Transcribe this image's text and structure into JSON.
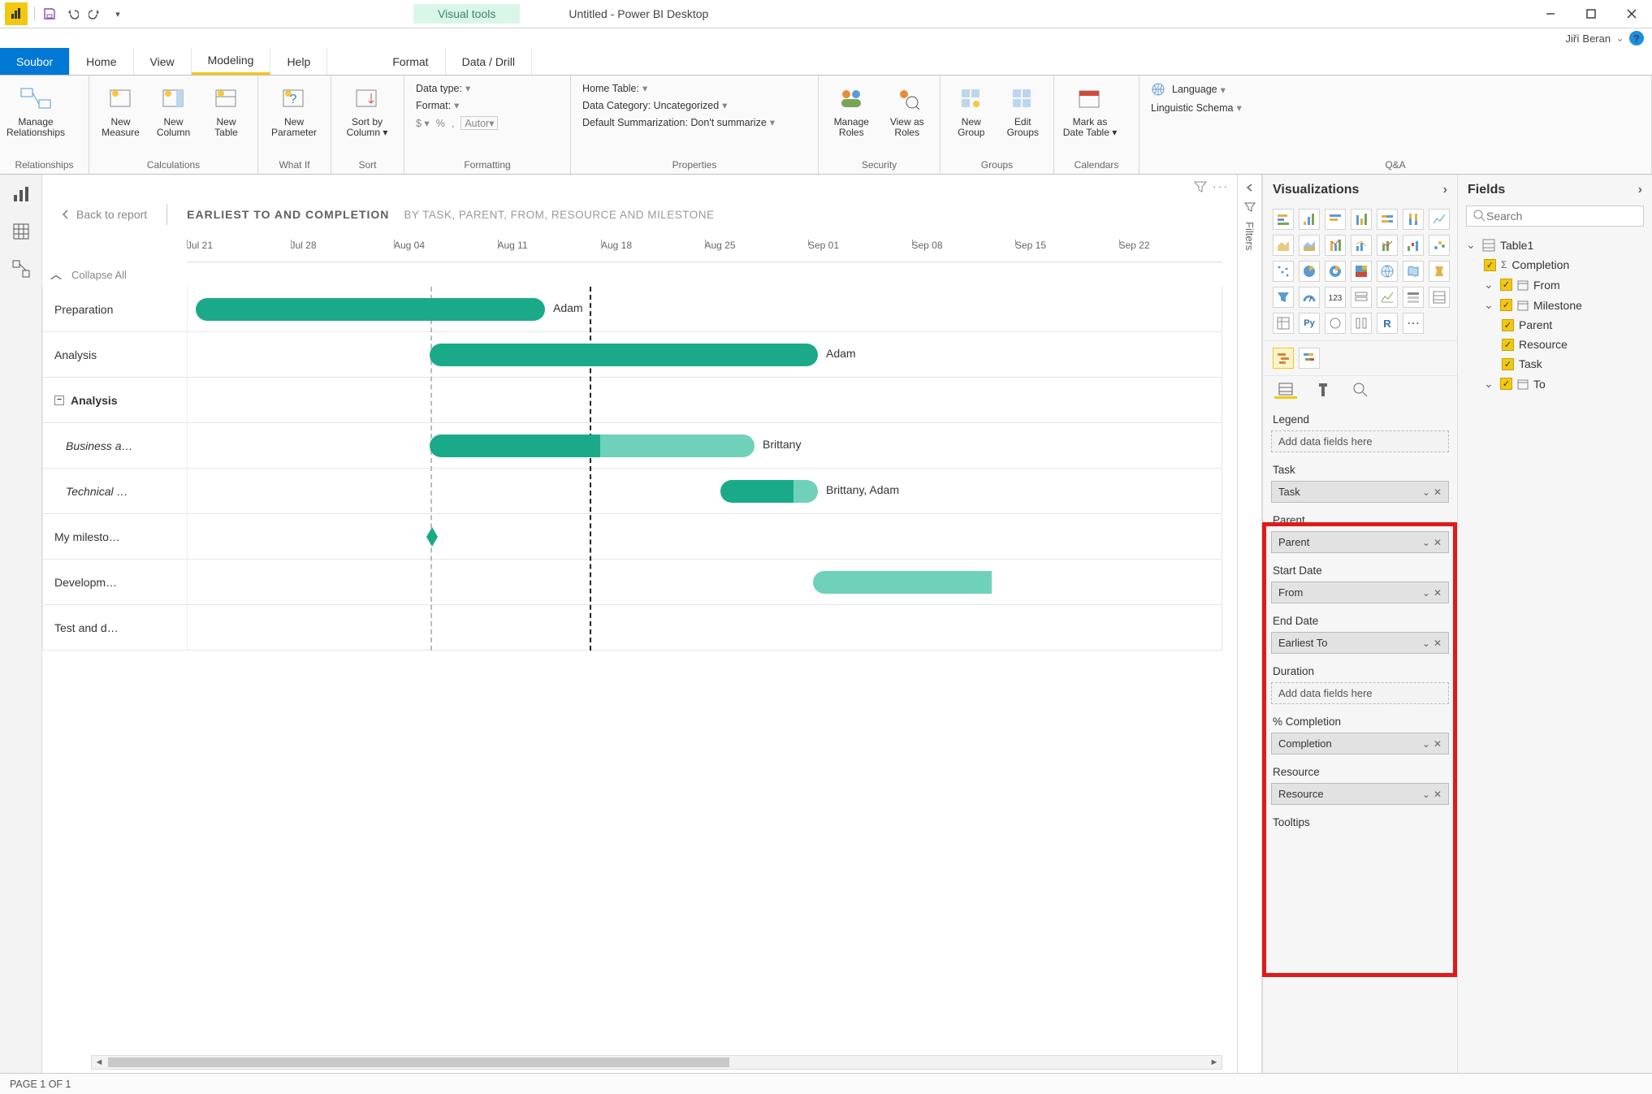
{
  "title": "Untitled - Power BI Desktop",
  "visual_tools_tab": "Visual tools",
  "user": "Jiří Beran",
  "tabs": {
    "file": "Soubor",
    "home": "Home",
    "view": "View",
    "modeling": "Modeling",
    "help": "Help",
    "format": "Format",
    "datadrill": "Data / Drill"
  },
  "ribbon_groups": {
    "relationships": "Relationships",
    "calculations": "Calculations",
    "whatif": "What If",
    "sort": "Sort",
    "formatting": "Formatting",
    "properties": "Properties",
    "security": "Security",
    "groups": "Groups",
    "calendars": "Calendars",
    "qa": "Q&A"
  },
  "ribbon": {
    "manage_rel": "Manage\nRelationships",
    "new_measure": "New\nMeasure",
    "new_column": "New\nColumn",
    "new_table": "New\nTable",
    "new_param": "New\nParameter",
    "sort_by": "Sort by\nColumn ▾",
    "data_type": "Data type:",
    "format_lbl": "Format:",
    "autor": "Autor",
    "home_table": "Home Table:",
    "data_cat": "Data Category: Uncategorized",
    "def_sum": "Default Summarization: Don't summarize",
    "manage_roles": "Manage\nRoles",
    "view_roles": "View as\nRoles",
    "new_group": "New\nGroup",
    "edit_groups": "Edit\nGroups",
    "mark_date": "Mark as\nDate Table ▾",
    "language": "Language",
    "schema": "Linguistic Schema"
  },
  "back_label": "Back to report",
  "canvas_title": "EARLIEST TO AND COMPLETION",
  "canvas_subtitle": "BY TASK, PARENT, FROM, RESOURCE AND MILESTONE",
  "collapse_all": "Collapse All",
  "timeline": [
    "Jul 21",
    "Jul 28",
    "Aug 04",
    "Aug 11",
    "Aug 18",
    "Aug 25",
    "Sep 01",
    "Sep 08",
    "Sep 15",
    "Sep 22"
  ],
  "tasks": [
    {
      "name": "Preparation",
      "label": "Adam"
    },
    {
      "name": "Analysis",
      "label": "Adam"
    },
    {
      "name": "Analysis",
      "group": true
    },
    {
      "name": "Business a…",
      "italic": true,
      "label": "Brittany"
    },
    {
      "name": "Technical …",
      "italic": true,
      "label": "Brittany, Adam"
    },
    {
      "name": "My milesto…"
    },
    {
      "name": "Developm…"
    },
    {
      "name": "Test and d…"
    }
  ],
  "filters_label": "Filters",
  "viz_title": "Visualizations",
  "well_sections": [
    {
      "title": "Legend",
      "value": null,
      "placeholder": "Add data fields here"
    },
    {
      "title": "Task",
      "value": "Task"
    },
    {
      "title": "Parent",
      "value": "Parent"
    },
    {
      "title": "Start Date",
      "value": "From"
    },
    {
      "title": "End Date",
      "value": "Earliest To"
    },
    {
      "title": "Duration",
      "value": null,
      "placeholder": "Add data fields here"
    },
    {
      "title": "% Completion",
      "value": "Completion"
    },
    {
      "title": "Resource",
      "value": "Resource"
    },
    {
      "title": "Tooltips",
      "value": null
    }
  ],
  "fields_title": "Fields",
  "search_placeholder": "Search",
  "table_name": "Table1",
  "fields": [
    "Completion",
    "From",
    "Milestone",
    "Parent",
    "Resource",
    "Task",
    "To"
  ],
  "status": "PAGE 1 OF 1"
}
